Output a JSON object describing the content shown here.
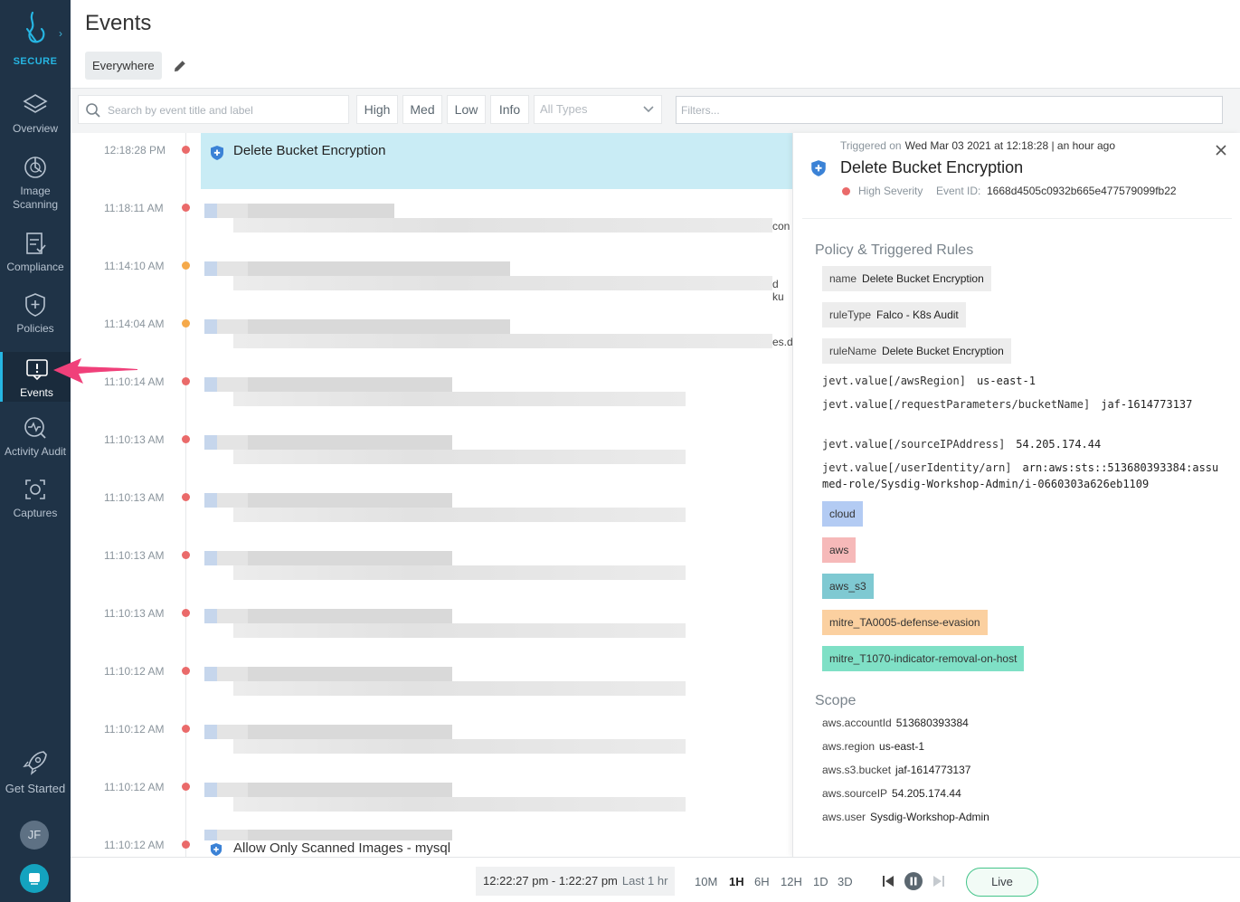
{
  "brand": {
    "label": "SECURE"
  },
  "sidebar": {
    "items": [
      {
        "label": "Overview",
        "icon": "layers-icon"
      },
      {
        "label": "Image Scanning",
        "icon": "scan-icon"
      },
      {
        "label": "Compliance",
        "icon": "compliance-icon"
      },
      {
        "label": "Policies",
        "icon": "shield-icon"
      },
      {
        "label": "Events",
        "icon": "events-icon",
        "active": true
      },
      {
        "label": "Activity Audit",
        "icon": "activity-icon"
      },
      {
        "label": "Captures",
        "icon": "captures-icon"
      }
    ],
    "get_started": "Get Started",
    "avatar_initials": "JF"
  },
  "header": {
    "title": "Events",
    "scope": "Everywhere"
  },
  "filters": {
    "search_placeholder": "Search by event title and label",
    "severity": [
      "High",
      "Med",
      "Low",
      "Info"
    ],
    "types_placeholder": "All Types",
    "filters_placeholder": "Filters..."
  },
  "events": [
    {
      "time": "12:18:28 PM",
      "severity": "high",
      "title": "Delete Bucket Encryption",
      "selected": true
    },
    {
      "time": "11:18:11 AM",
      "severity": "high",
      "trunc": "con"
    },
    {
      "time": "11:14:10 AM",
      "severity": "medium",
      "trunc": "d ku"
    },
    {
      "time": "11:14:04 AM",
      "severity": "medium",
      "trunc": "es.d"
    },
    {
      "time": "11:10:14 AM",
      "severity": "high"
    },
    {
      "time": "11:10:13 AM",
      "severity": "high"
    },
    {
      "time": "11:10:13 AM",
      "severity": "high"
    },
    {
      "time": "11:10:13 AM",
      "severity": "high"
    },
    {
      "time": "11:10:13 AM",
      "severity": "high"
    },
    {
      "time": "11:10:12 AM",
      "severity": "high"
    },
    {
      "time": "11:10:12 AM",
      "severity": "high"
    },
    {
      "time": "11:10:12 AM",
      "severity": "high"
    },
    {
      "time": "11:10:12 AM",
      "severity": "high",
      "title": "Allow Only Scanned Images - mysql"
    }
  ],
  "detail": {
    "triggered_label": "Triggered on",
    "triggered_value": "Wed Mar 03 2021 at 12:18:28 | an hour ago",
    "title": "Delete Bucket Encryption",
    "severity": "High Severity",
    "event_id_label": "Event ID:",
    "event_id": "1668d4505c0932b665e477579099fb22",
    "policy_section": "Policy & Triggered Rules",
    "rules": [
      {
        "key": "name",
        "value": "Delete Bucket Encryption"
      },
      {
        "key": "ruleType",
        "value": "Falco - K8s Audit"
      },
      {
        "key": "ruleName",
        "value": "Delete Bucket Encryption"
      }
    ],
    "fields": [
      {
        "key": "jevt.value[/awsRegion]",
        "value": "us-east-1"
      },
      {
        "key": "jevt.value[/requestParameters/bucketName]",
        "value": "jaf-1614773137"
      },
      {
        "key": "jevt.value[/sourceIPAddress]",
        "value": "54.205.174.44"
      },
      {
        "key": "jevt.value[/userIdentity/arn]",
        "value": "arn:aws:sts::513680393384:assumed-role/Sysdig-Workshop-Admin/i-0660303a626eb1109"
      }
    ],
    "tags": [
      {
        "label": "cloud",
        "color": "#b3cbf3"
      },
      {
        "label": "aws",
        "color": "#f6b9b9"
      },
      {
        "label": "aws_s3",
        "color": "#7fc9d2"
      },
      {
        "label": "mitre_TA0005-defense-evasion",
        "color": "#fbd0a0"
      },
      {
        "label": "mitre_T1070-indicator-removal-on-host",
        "color": "#7fe0c6"
      }
    ],
    "scope_section": "Scope",
    "scope": [
      {
        "key": "aws.accountId",
        "value": "513680393384"
      },
      {
        "key": "aws.region",
        "value": "us-east-1"
      },
      {
        "key": "aws.s3.bucket",
        "value": "jaf-1614773137"
      },
      {
        "key": "aws.sourceIP",
        "value": "54.205.174.44"
      },
      {
        "key": "aws.user",
        "value": "Sysdig-Workshop-Admin"
      }
    ]
  },
  "timebar": {
    "range": "12:22:27 pm - 1:22:27 pm",
    "range_label": "Last 1 hr",
    "options": [
      "10M",
      "1H",
      "6H",
      "12H",
      "1D",
      "3D"
    ],
    "active_option": "1H",
    "live": "Live"
  },
  "colors": {
    "high": "#ea6a6a",
    "medium": "#f5a94a",
    "accent": "#26b6e3",
    "selected_row": "#c9ecf5"
  }
}
